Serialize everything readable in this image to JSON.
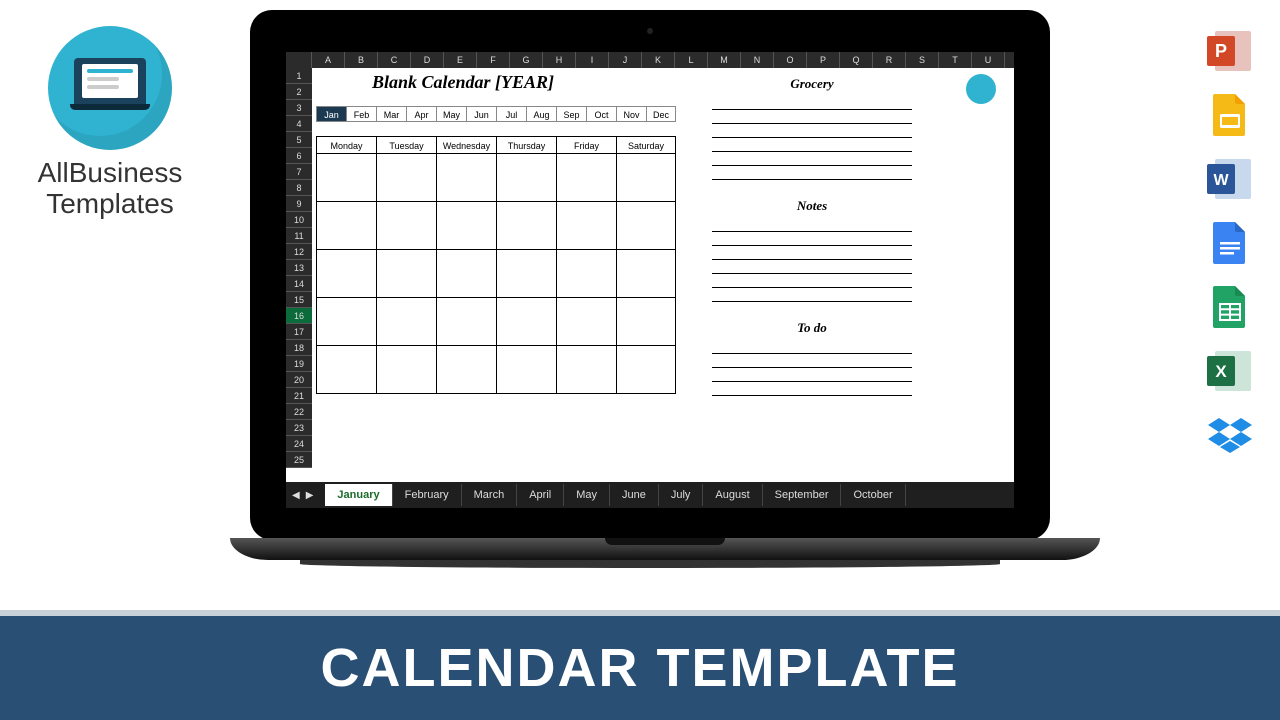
{
  "logo": {
    "line1": "AllBusiness",
    "line2": "Templates"
  },
  "banner": {
    "text": "CALENDAR TEMPLATE"
  },
  "spreadsheet": {
    "columns": [
      "A",
      "B",
      "C",
      "D",
      "E",
      "F",
      "G",
      "H",
      "I",
      "J",
      "K",
      "L",
      "M",
      "N",
      "O",
      "P",
      "Q",
      "R",
      "S",
      "T",
      "U"
    ],
    "rows_visible": 25,
    "selected_row": 16,
    "title": "Blank Calendar [YEAR]",
    "months": [
      "Jan",
      "Feb",
      "Mar",
      "Apr",
      "May",
      "Jun",
      "Jul",
      "Aug",
      "Sep",
      "Oct",
      "Nov",
      "Dec"
    ],
    "active_month_index": 0,
    "days": [
      "Monday",
      "Tuesday",
      "Wednesday",
      "Thursday",
      "Friday",
      "Saturday"
    ],
    "weeks": 5,
    "side_sections": [
      {
        "title": "Grocery",
        "top_title": 8,
        "top_lines": 28,
        "lines": 6
      },
      {
        "title": "Notes",
        "top_title": 130,
        "top_lines": 150,
        "lines": 6
      },
      {
        "title": "To do",
        "top_title": 252,
        "top_lines": 272,
        "lines": 4
      }
    ],
    "tabs": [
      "January",
      "February",
      "March",
      "April",
      "May",
      "June",
      "July",
      "August",
      "September",
      "October"
    ],
    "active_tab_index": 0
  },
  "app_icons": [
    {
      "name": "powerpoint-icon"
    },
    {
      "name": "google-slides-icon"
    },
    {
      "name": "word-icon"
    },
    {
      "name": "google-docs-icon"
    },
    {
      "name": "google-sheets-icon"
    },
    {
      "name": "excel-icon"
    },
    {
      "name": "dropbox-icon"
    }
  ]
}
